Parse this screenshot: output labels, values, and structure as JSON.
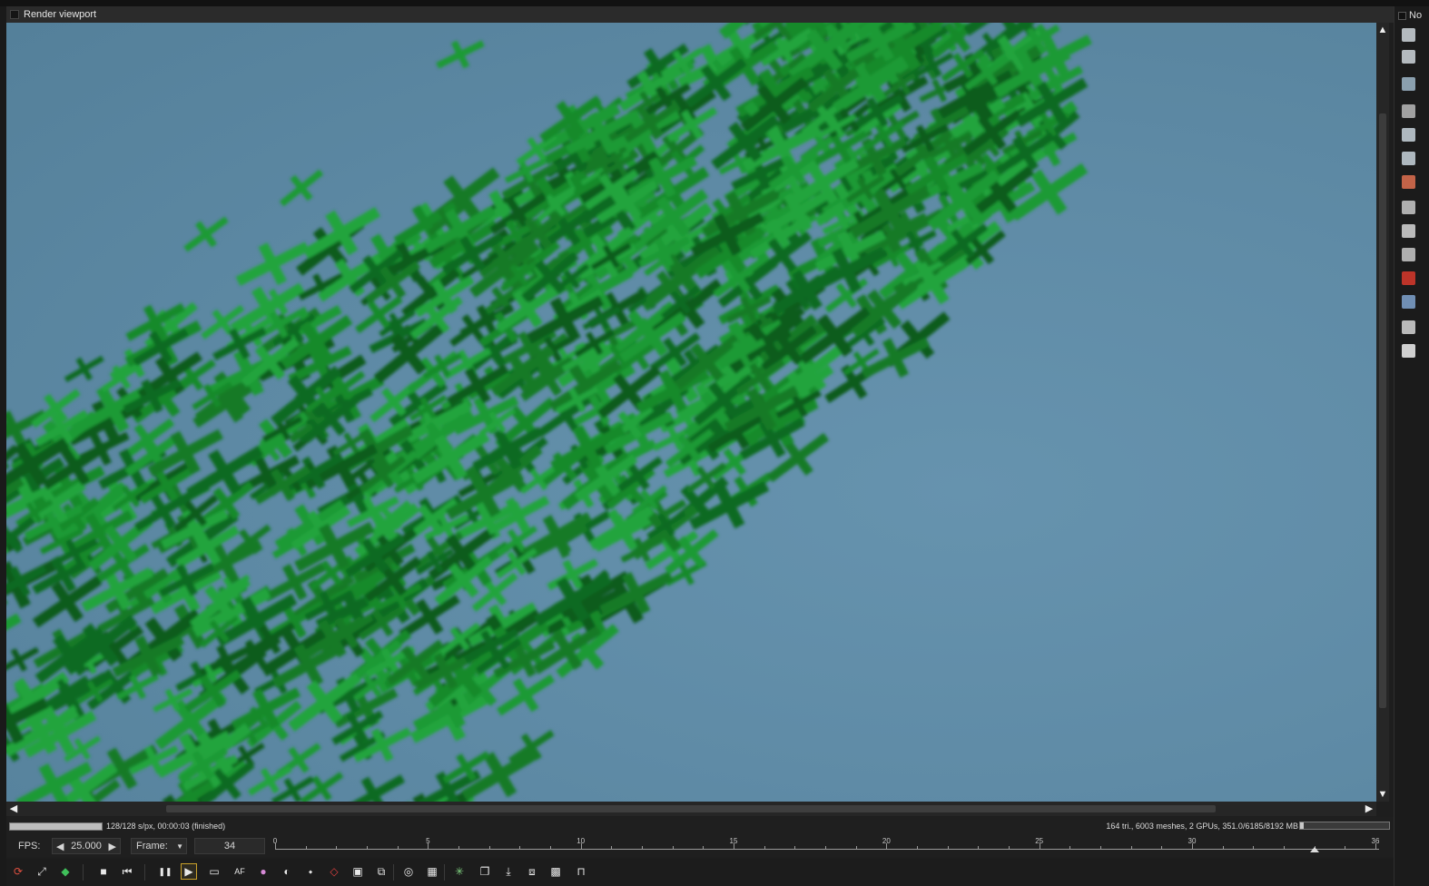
{
  "window": {
    "title": "Render viewport"
  },
  "right_panel": {
    "title": "No",
    "icons": [
      "layers-icon",
      "tree-icon",
      "image-icon",
      "settings-icon",
      "database-icon",
      "database-refresh-icon",
      "material-icon",
      "frame-icon",
      "clock-icon",
      "graph-icon",
      "red-cube-icon",
      "blue-cube-icon",
      "picture-icon",
      "sun-icon"
    ]
  },
  "status": {
    "render_info": "128/128 s/px, 00:00:03 (finished)",
    "scene_info": "164 tri., 6003 meshes, 2 GPUs, 351.0/6185/8192 MB",
    "progress": 1.0,
    "memory_fraction": 0.04
  },
  "controls": {
    "fps_label": "FPS:",
    "fps_value": "25.000",
    "frame_label": "Frame:",
    "frame_value": "34",
    "timeline_ticks": [
      "0",
      "5",
      "10",
      "15",
      "20",
      "25",
      "30",
      "36"
    ],
    "timeline_min": 0,
    "timeline_max": 36,
    "current_frame": 34
  },
  "toolbar": {
    "buttons": [
      "refresh-render-icon",
      "fit-view-icon",
      "color-cube-icon",
      "stop-icon",
      "rewind-icon",
      "pause-icon",
      "play-icon",
      "screen-icon",
      "af-icon",
      "color-picker-icon",
      "camera-icon",
      "material-pick-icon",
      "object-pick-icon",
      "region-icon",
      "crop-icon",
      "focus-icon",
      "grid-icon",
      "spark-icon",
      "copy-icon",
      "save-icon",
      "export-icon",
      "checker-icon",
      "lock-icon"
    ]
  },
  "colors": {
    "viewport_bg": "#5f8ba6",
    "leaf_green": "#1e8a2e",
    "ui_dark": "#1e1e1e"
  }
}
